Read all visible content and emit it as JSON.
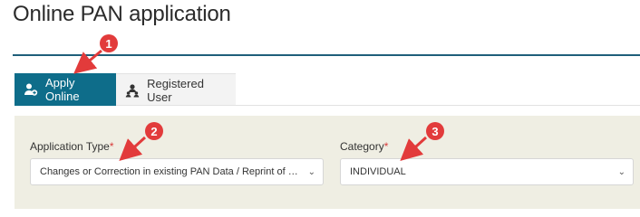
{
  "page": {
    "title": "Online PAN application"
  },
  "tabs": [
    {
      "label": "Apply Online",
      "icon": "user-add-icon",
      "active": true
    },
    {
      "label": "Registered User",
      "icon": "user-group-icon",
      "active": false
    }
  ],
  "form": {
    "application_type": {
      "label": "Application Type",
      "required_mark": "*",
      "value": "Changes or Correction in existing PAN Data / Reprint of PAN Card (No changes in Existing PAN Data)"
    },
    "category": {
      "label": "Category",
      "required_mark": "*",
      "value": "INDIVIDUAL"
    }
  },
  "annotations": {
    "markers": [
      "1",
      "2",
      "3"
    ],
    "color": "#e23b3b"
  },
  "colors": {
    "accent": "#0e6d8a",
    "panel_bg": "#efeee3",
    "title_rule": "#1f5f7a"
  }
}
